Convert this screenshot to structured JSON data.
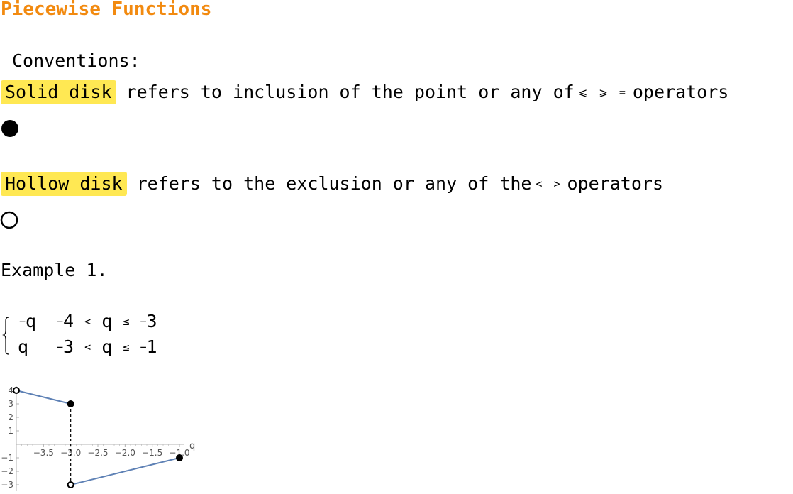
{
  "heading": {
    "title": "Piecewise Functions"
  },
  "conventions": {
    "label": "Conventions:",
    "solid": {
      "tag": "Solid disk",
      "text": "refers to inclusion of the point or any of",
      "operators": [
        "⩽",
        "⩾",
        "="
      ],
      "tail": "operators"
    },
    "hollow": {
      "tag": "Hollow disk",
      "text": "refers to the exclusion or any of the",
      "operators": [
        "<",
        ">"
      ],
      "tail": "operators"
    }
  },
  "example": {
    "label": "Example 1.",
    "piecewise": [
      {
        "expr": "q",
        "sign": "−",
        "lower": "4",
        "lower_sign": "−",
        "rel1": "<",
        "var": "q",
        "rel2": "≤",
        "upper_sign": "−",
        "upper": "3"
      },
      {
        "expr": "q",
        "sign": "",
        "lower": "3",
        "lower_sign": "−",
        "rel1": "<",
        "var": "q",
        "rel2": "≤",
        "upper_sign": "−",
        "upper": "1"
      }
    ]
  },
  "chart_data": {
    "type": "line",
    "xlabel": "q",
    "ylabel": "",
    "xlim": [
      -4,
      -1
    ],
    "ylim": [
      -3,
      4
    ],
    "x_ticks": [
      -3.5,
      -3.0,
      -2.5,
      -2.0,
      -1.5,
      -1.0
    ],
    "x_tick_labels": [
      "−3.5",
      "−3.0",
      "−2.5",
      "−2.0",
      "−1.5",
      "−1.0"
    ],
    "y_ticks": [
      4,
      3,
      2,
      1,
      -1,
      -2,
      -3
    ],
    "y_tick_labels": [
      "4",
      "3",
      "2",
      "1",
      "−1",
      "−2",
      "−3"
    ],
    "segments": [
      {
        "x": [
          -4,
          -3
        ],
        "y": [
          4,
          3
        ]
      },
      {
        "x": [
          -3,
          -1
        ],
        "y": [
          -3,
          -1
        ]
      }
    ],
    "points": [
      {
        "x": -4,
        "y": 4,
        "filled": false
      },
      {
        "x": -3,
        "y": 3,
        "filled": true
      },
      {
        "x": -3,
        "y": -3,
        "filled": false
      },
      {
        "x": -1,
        "y": -1,
        "filled": true
      }
    ],
    "discontinuity_x": -3,
    "line_color": "#5e81b5",
    "grid": false
  }
}
